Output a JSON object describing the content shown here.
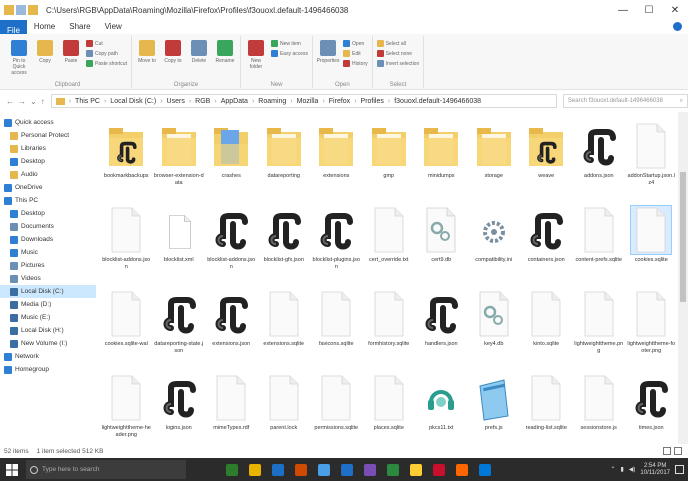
{
  "window": {
    "title": "C:\\Users\\RGB\\AppData\\Roaming\\Mozilla\\Firefox\\Profiles\\f3ouoxl.default-1496466038",
    "controls": {
      "minimize": "—",
      "maximize": "☐",
      "close": "✕"
    }
  },
  "ribbon": {
    "tabs": [
      "File",
      "Home",
      "Share",
      "View"
    ],
    "groups": [
      {
        "label": "Clipboard",
        "buttons": [
          "Pin to Quick access",
          "Copy",
          "Paste"
        ],
        "small": [
          "Cut",
          "Copy path",
          "Paste shortcut"
        ]
      },
      {
        "label": "Organize",
        "buttons": [
          "Move to",
          "Copy to",
          "Delete",
          "Rename"
        ],
        "small": []
      },
      {
        "label": "New",
        "buttons": [
          "New folder"
        ],
        "small": [
          "New item",
          "Easy access"
        ]
      },
      {
        "label": "Open",
        "buttons": [
          "Properties"
        ],
        "small": [
          "Open",
          "Edit",
          "History"
        ]
      },
      {
        "label": "Select",
        "buttons": [],
        "small": [
          "Select all",
          "Select none",
          "Invert selection"
        ]
      }
    ]
  },
  "nav": {
    "buttons": [
      "←",
      "→",
      "⌄",
      "↑"
    ],
    "crumbs": [
      "This PC",
      "Local Disk (C:)",
      "Users",
      "RGB",
      "AppData",
      "Roaming",
      "Mozilla",
      "Firefox",
      "Profiles",
      "f3ouoxl.default-1496466038"
    ],
    "search_placeholder": "Search f3ouoxl.default-1496466038"
  },
  "sidebar": [
    {
      "label": "Quick access",
      "icon": "star-icon",
      "color": "#2f7fd4",
      "indent": 0
    },
    {
      "label": "Personal Protect",
      "icon": "folder-icon",
      "color": "#e6b74c",
      "indent": 1
    },
    {
      "label": "Libraries",
      "icon": "folder-icon",
      "color": "#e6b74c",
      "indent": 1
    },
    {
      "label": "Desktop",
      "icon": "desktop-icon",
      "color": "#2f7fd4",
      "indent": 1
    },
    {
      "label": "Audio",
      "icon": "folder-icon",
      "color": "#e6b74c",
      "indent": 1
    },
    {
      "label": "OneDrive",
      "icon": "cloud-icon",
      "color": "#2f7fd4",
      "indent": 0
    },
    {
      "label": "This PC",
      "icon": "pc-icon",
      "color": "#2f7fd4",
      "indent": 0
    },
    {
      "label": "Desktop",
      "icon": "desktop-icon",
      "color": "#2f7fd4",
      "indent": 1
    },
    {
      "label": "Documents",
      "icon": "documents-icon",
      "color": "#6d8fb5",
      "indent": 1
    },
    {
      "label": "Downloads",
      "icon": "download-icon",
      "color": "#2f7fd4",
      "indent": 1
    },
    {
      "label": "Music",
      "icon": "music-icon",
      "color": "#2f7fd4",
      "indent": 1
    },
    {
      "label": "Pictures",
      "icon": "pictures-icon",
      "color": "#6d8fb5",
      "indent": 1
    },
    {
      "label": "Videos",
      "icon": "videos-icon",
      "color": "#6d8fb5",
      "indent": 1
    },
    {
      "label": "Local Disk (C:)",
      "icon": "drive-icon",
      "color": "#3b6fa3",
      "indent": 1,
      "selected": true
    },
    {
      "label": "Media (D:)",
      "icon": "drive-icon",
      "color": "#3b6fa3",
      "indent": 1
    },
    {
      "label": "Music (E:)",
      "icon": "drive-icon",
      "color": "#3b6fa3",
      "indent": 1
    },
    {
      "label": "Local Disk (H:)",
      "icon": "drive-icon",
      "color": "#3b6fa3",
      "indent": 1
    },
    {
      "label": "New Volume (I:)",
      "icon": "drive-icon",
      "color": "#3b6fa3",
      "indent": 1
    },
    {
      "label": "Network",
      "icon": "network-icon",
      "color": "#2f7fd4",
      "indent": 0
    },
    {
      "label": "Homegroup",
      "icon": "homegroup-icon",
      "color": "#2f7fd4",
      "indent": 0
    }
  ],
  "files": [
    {
      "name": "bookmarkbackups",
      "kind": "folder-json"
    },
    {
      "name": "browser-extension-data",
      "kind": "folder"
    },
    {
      "name": "crashes",
      "kind": "folder-blue"
    },
    {
      "name": "datareporting",
      "kind": "folder"
    },
    {
      "name": "extensions",
      "kind": "folder"
    },
    {
      "name": "gmp",
      "kind": "folder"
    },
    {
      "name": "minidumps",
      "kind": "folder"
    },
    {
      "name": "storage",
      "kind": "folder"
    },
    {
      "name": "weave",
      "kind": "folder-json"
    },
    {
      "name": "addons.json",
      "kind": "json"
    },
    {
      "name": "addonStartup.json.lz4",
      "kind": "blank"
    },
    {
      "name": "blocklist-addons.json",
      "kind": "blank"
    },
    {
      "name": "blocklist.xml",
      "kind": "doc"
    },
    {
      "name": "blocklist-addons.json",
      "kind": "json"
    },
    {
      "name": "blocklist-gfx.json",
      "kind": "json"
    },
    {
      "name": "blocklist-plugins.json",
      "kind": "json"
    },
    {
      "name": "cert_override.txt",
      "kind": "blank"
    },
    {
      "name": "cert9.db",
      "kind": "gear"
    },
    {
      "name": "compatibility.ini",
      "kind": "gear-multi"
    },
    {
      "name": "containers.json",
      "kind": "json"
    },
    {
      "name": "content-prefs.sqlite",
      "kind": "blank"
    },
    {
      "name": "cookies.sqlite",
      "kind": "blank",
      "selected": true
    },
    {
      "name": "cookies.sqlite-wal",
      "kind": "blank"
    },
    {
      "name": "datareporting-state.json",
      "kind": "json"
    },
    {
      "name": "extensions.json",
      "kind": "json"
    },
    {
      "name": "extensions.sqlite",
      "kind": "blank"
    },
    {
      "name": "favicons.sqlite",
      "kind": "blank"
    },
    {
      "name": "formhistory.sqlite",
      "kind": "blank"
    },
    {
      "name": "handlers.json",
      "kind": "json"
    },
    {
      "name": "key4.db",
      "kind": "gear"
    },
    {
      "name": "kinto.sqlite",
      "kind": "blank"
    },
    {
      "name": "lightweighttheme.png",
      "kind": "blank"
    },
    {
      "name": "lightweighttheme-footer.png",
      "kind": "blank"
    },
    {
      "name": "lightweighttheme-header.png",
      "kind": "blank"
    },
    {
      "name": "logins.json",
      "kind": "json"
    },
    {
      "name": "mimeTypes.rdf",
      "kind": "blank"
    },
    {
      "name": "parent.lock",
      "kind": "blank"
    },
    {
      "name": "permissions.sqlite",
      "kind": "blank"
    },
    {
      "name": "places.sqlite",
      "kind": "blank"
    },
    {
      "name": "pkcs11.txt",
      "kind": "headset"
    },
    {
      "name": "prefs.js",
      "kind": "notepad"
    },
    {
      "name": "reading-list.sqlite",
      "kind": "blank"
    },
    {
      "name": "sessionstore.js",
      "kind": "blank"
    },
    {
      "name": "times.json",
      "kind": "json"
    }
  ],
  "status": {
    "count": "52 items",
    "selection": "1 item selected  512 KB"
  },
  "taskbar": {
    "search_placeholder": "Type here to search",
    "apps": [
      "#2d7d2d",
      "#e8b400",
      "#1e6fc8",
      "#d04a02",
      "#4aa0e6",
      "#1e6fc8",
      "#7a4fb5",
      "#2b8a3e",
      "#ffcc33",
      "#c8102e",
      "#ff6600",
      "#0078d7"
    ],
    "time": "2:54 PM",
    "date": "10/11/2017"
  }
}
